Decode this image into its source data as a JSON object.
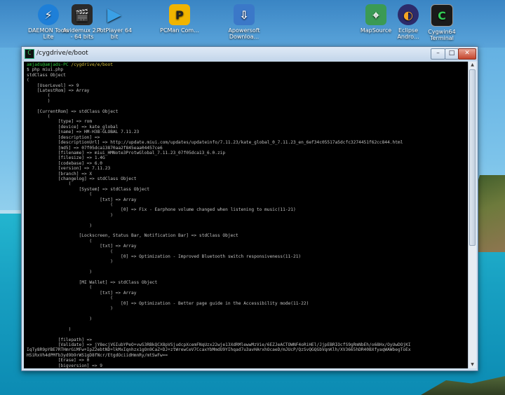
{
  "desktop": {
    "icons": [
      {
        "label": "DAEMON Tools Lite",
        "icon": "daemon-tools-icon",
        "color": "#1e7fd8"
      },
      {
        "label": "Avidemux 2.7 - 64 bits",
        "icon": "avidemux-icon",
        "color": "#2a2a2a"
      },
      {
        "label": "PotPlayer 64 bit",
        "icon": "potplayer-icon",
        "color": "#3aa0e6"
      },
      {
        "label": "PCMan Com...",
        "icon": "pcman-icon",
        "color": "#f0b400"
      },
      {
        "label": "Apowersoft Downloa...",
        "icon": "apowersoft-icon",
        "color": "#3b78c8"
      },
      {
        "label": "MapSource",
        "icon": "mapsource-icon",
        "color": "#3b9a55"
      },
      {
        "label": "Eclipse Andro...",
        "icon": "eclipse-icon",
        "color": "#2c2b6a"
      },
      {
        "label": "Cygwin64 Terminal",
        "icon": "cygwin-icon",
        "color": "#1a1a1a"
      }
    ]
  },
  "window": {
    "title": "/cygdrive/e/boot",
    "icon": "cygwin-terminal-icon",
    "minimize": "–",
    "maximize": "□",
    "close": "✕"
  },
  "terminal": {
    "prompt_user": "amjads@amjads-PC",
    "prompt_path": "/cygdrive/e/boot",
    "command": "$ php miui.php",
    "output": "stdClass Object\n(\n    [UserLevel] => 9\n    [LatestRom] => Array\n        (\n        )\n\n    [CurrentRom] => stdClass Object\n        (\n            [type] => rom\n            [device] => kate_global\n            [name] => HM-H3B-GLOBAL 7.11.23\n            [description] =>\n            [descriptionUrl] => http://update.miui.com/updates/updateinfo/7.11.23/kate_global_0_7.11.23_en_6ef34c05517a5dcfc3274451f62cc844.html\n            [md5] => 07f05dca13870aa2f845eaa04457ce6\n            [filename] => miui_HMNote3ProtwGlobal_7.11.23_07f05dca13_6.0.zip\n            [filesize] => 1.4G\n            [codebase] => 6.0\n            [version] => 7.11.23\n            [branch] => X\n            [changelog] => stdClass Object\n                (\n                    [System] => stdClass Object\n                        (\n                            [txt] => Array\n                                (\n                                    [0] => Fix - Earphone volume changed when listening to music(11-21)\n                                )\n\n                        )\n\n                    [Lockscreen, Status Bar, Notification Bar] => stdClass Object\n                        (\n                            [txt] => Array\n                                (\n                                    [0] => Optimization - Improved Bluetooth switch responsiveness(11-21)\n                                )\n\n                        )\n\n                    [MI Wallet] => stdClass Object\n                        (\n                            [txt] => Array\n                                (\n                                    [0] => Optimization - Better page guide in the Accessibility mode(11-22)\n                                )\n\n                        )\n\n                )\n\n            [filepath] =>\n            [Validate] => jY8ecjVGIubYPeO+vwS3RBkQCX8pVSjudcpXcemFNqUzx22wje13XdRMlewwMzVie/6EZJeACTOWNF4oRiHEl/JjpEBRIOcfS9gRmNbEh/o68Hx/OyUwDOjKI\nIqTy8R9pYBE7RTHmrGiMFw+IpZ2ebtND+lkMxIqnhzx1gOn9CaZ+DJ+ztWrewCeV7CcaxYbMmdU9YIhqad7u3avHArxhOcaeD/mJUcP/QzSvQGQGbVqnKlh/XV3665hDR40BXfyaqWAWbegToEx\nHSiRxVh4dPMfb3yd9b9rWS1gD8fNcr/EtgdOciidHmnRy/mtSwFw==\n            [Erase] => 0\n            [bigversion] => 9"
  }
}
